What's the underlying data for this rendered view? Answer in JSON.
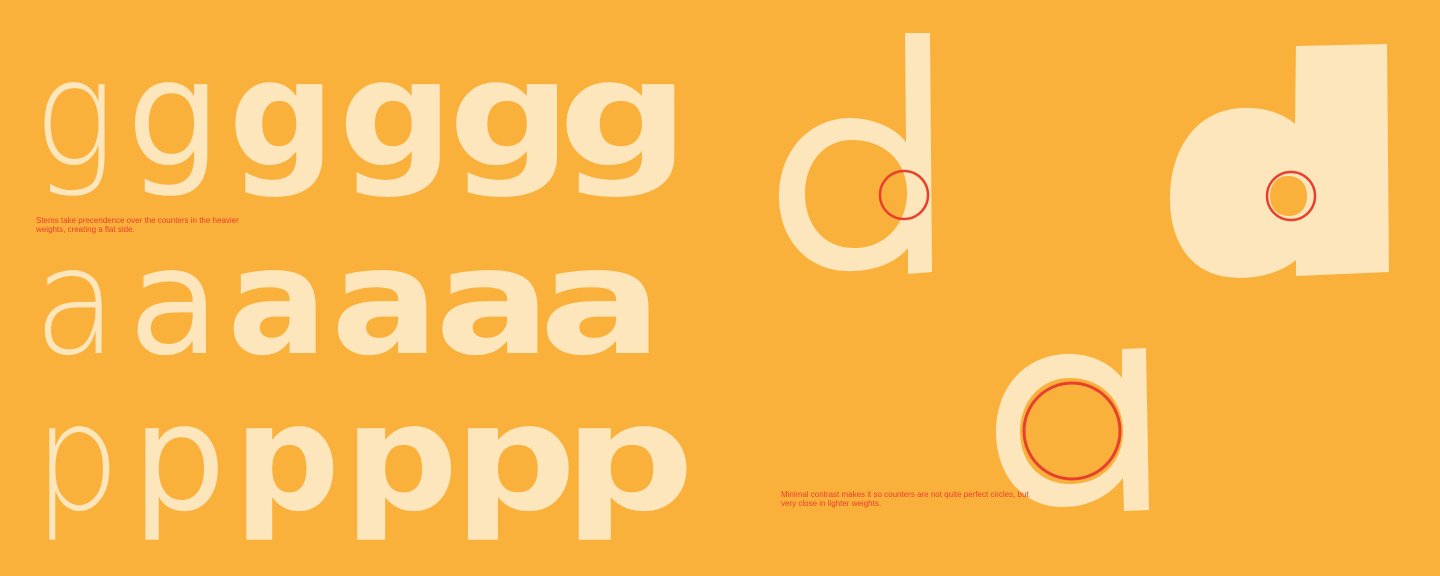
{
  "colors": {
    "background": "#FAB13C",
    "glyph": "#FDE5BC",
    "accent": "#E8402C"
  },
  "rows": {
    "g": [
      "g",
      "g",
      "g",
      "g",
      "g",
      "g"
    ],
    "a": [
      "a",
      "a",
      "a",
      "a",
      "a",
      "a"
    ],
    "p": [
      "p",
      "p",
      "p",
      "p",
      "p",
      "p"
    ]
  },
  "notes": {
    "stems": "Stems take precendence over the counters in the heavier weights, creating a flat side.",
    "contrast": "Minimal contrast makes it so counters are not quite perfect circles, but very close in lighter weights."
  }
}
